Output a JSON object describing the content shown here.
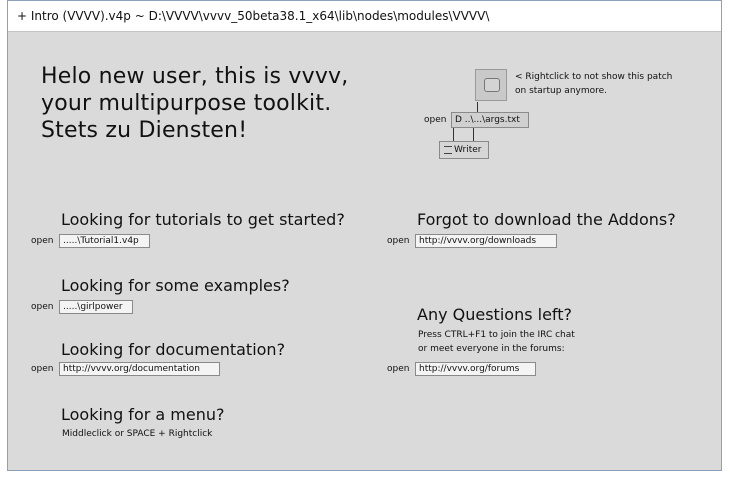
{
  "window": {
    "title": "+ Intro (VVVV).v4p ~  D:\\VVVV\\vvvv_50beta38.1_x64\\lib\\nodes\\modules\\VVVV\\"
  },
  "intro": {
    "line1": "Helo new user, this is vvvv,",
    "line2": "your multipurpose toolkit.",
    "line3": "Stets zu Diensten!"
  },
  "startup": {
    "note_line1": "< Rightclick to not show this patch",
    "note_line2": "on startup anymore.",
    "open_label": "open",
    "file_value": "D ..\\...\\args.txt",
    "writer_label": "Writer"
  },
  "left": {
    "tutorials": {
      "heading": "Looking for tutorials to get started?",
      "open_label": "open",
      "value": ".....\\Tutorial1.v4p"
    },
    "examples": {
      "heading": "Looking for some examples?",
      "open_label": "open",
      "value": ".....\\girlpower"
    },
    "documentation": {
      "heading": "Looking for documentation?",
      "open_label": "open",
      "value": "http://vvvv.org/documentation"
    },
    "menu": {
      "heading": "Looking for a menu?",
      "hint": "Middleclick or SPACE + Rightclick"
    }
  },
  "right": {
    "addons": {
      "heading": "Forgot to download the Addons?",
      "open_label": "open",
      "value": "http://vvvv.org/downloads"
    },
    "questions": {
      "heading": "Any Questions left?",
      "line1": "Press CTRL+F1 to join the IRC chat",
      "line2": "or meet everyone in the forums:",
      "open_label": "open",
      "value": "http://vvvv.org/forums"
    }
  }
}
